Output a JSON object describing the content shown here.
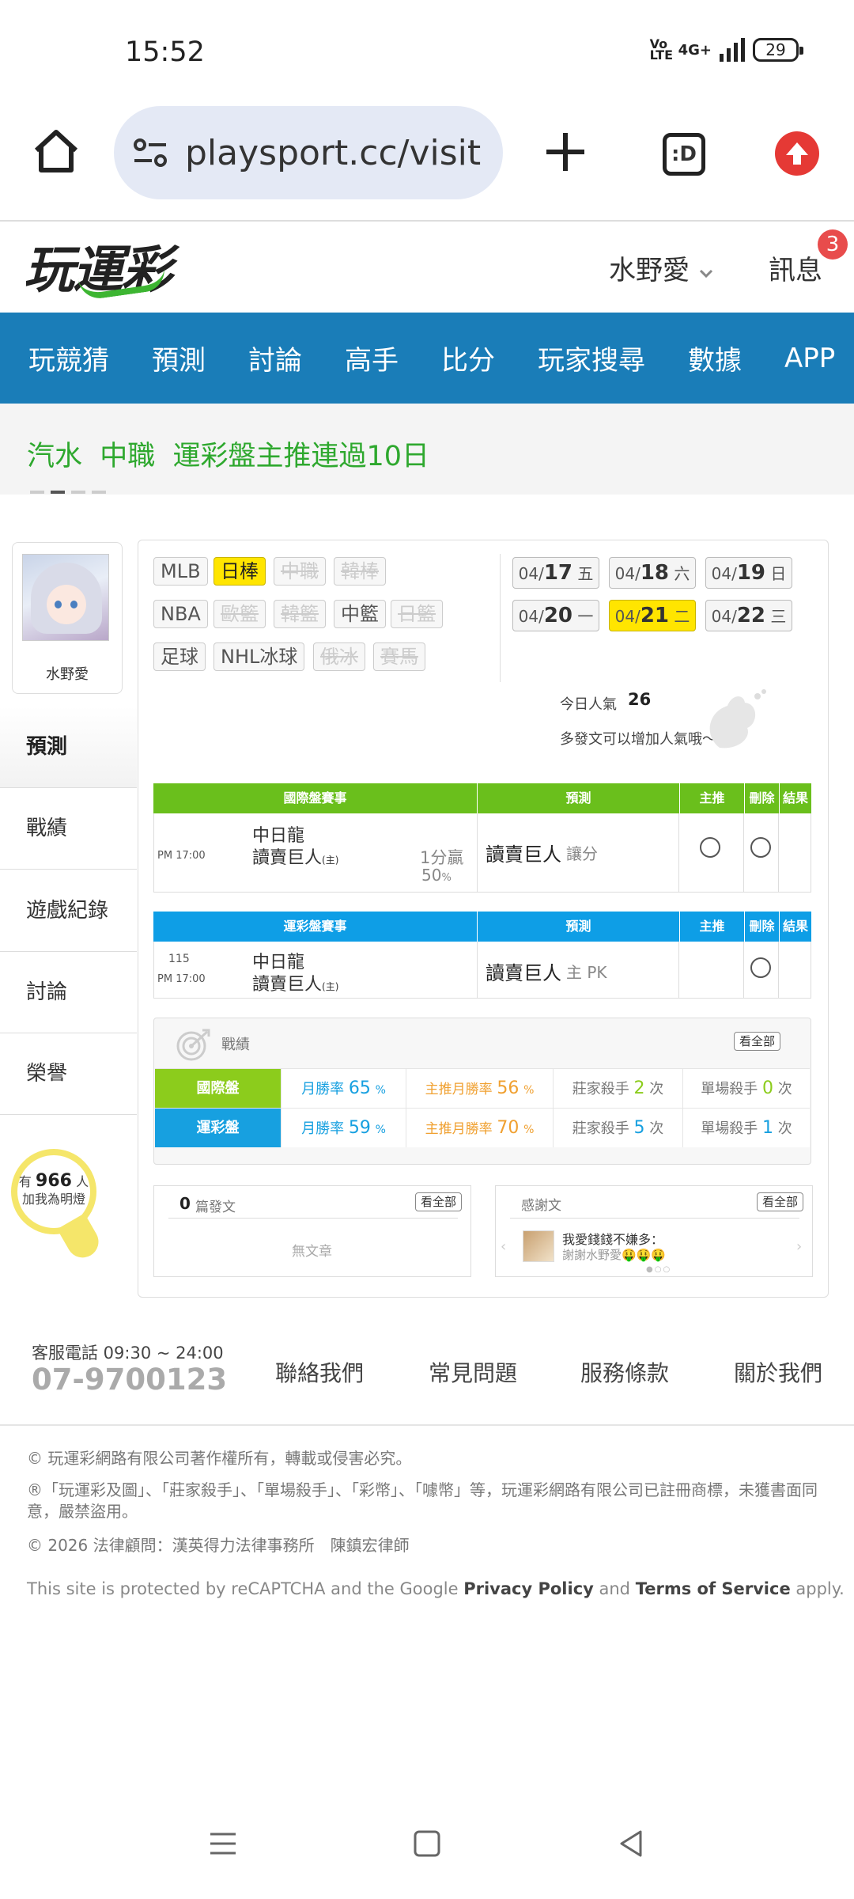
{
  "status_bar": {
    "time": "15:52",
    "network": "4G+",
    "volte": "Vo LTE",
    "battery": "29"
  },
  "browser": {
    "url": "playsport.cc/visit",
    "tab_label": ":D"
  },
  "site": {
    "logo": "玩運彩",
    "username": "水野愛",
    "messages_label": "訊息",
    "messages_badge": "3",
    "nav": [
      "玩競猜",
      "預測",
      "討論",
      "高手",
      "比分",
      "玩家搜尋",
      "數據",
      "APP"
    ],
    "banner": "汽水  中職  運彩盤主推連過10日"
  },
  "sidebar": {
    "avatar_name": "水野愛",
    "items": [
      "預測",
      "戰績",
      "遊戲紀錄",
      "討論",
      "榮譽"
    ],
    "bulb": {
      "prefix": "有",
      "count": "966",
      "suffix": "人",
      "line2": "加我為明燈"
    }
  },
  "sports": {
    "row1": [
      {
        "label": "MLB",
        "state": "normal"
      },
      {
        "label": "日棒",
        "state": "on"
      },
      {
        "label": "中職",
        "state": "off"
      },
      {
        "label": "韓棒",
        "state": "off"
      }
    ],
    "row2": [
      {
        "label": "NBA",
        "state": "normal"
      },
      {
        "label": "歐籃",
        "state": "off"
      },
      {
        "label": "韓籃",
        "state": "off"
      },
      {
        "label": "中籃",
        "state": "normal"
      },
      {
        "label": "日籃",
        "state": "off"
      }
    ],
    "row3": [
      {
        "label": "足球",
        "state": "normal"
      },
      {
        "label": "NHL冰球",
        "state": "normal"
      },
      {
        "label": "俄冰",
        "state": "off"
      },
      {
        "label": "賽馬",
        "state": "off"
      }
    ]
  },
  "dates": [
    {
      "md": "04/",
      "d": "17",
      "w": "五"
    },
    {
      "md": "04/",
      "d": "18",
      "w": "六"
    },
    {
      "md": "04/",
      "d": "19",
      "w": "日"
    },
    {
      "md": "04/",
      "d": "20",
      "w": "一"
    },
    {
      "md": "04/",
      "d": "21",
      "w": "二"
    },
    {
      "md": "04/",
      "d": "22",
      "w": "三"
    }
  ],
  "popularity": {
    "label": "今日人氣",
    "value": "26",
    "hint": "多發文可以增加人氣哦～"
  },
  "intl_table": {
    "headers": [
      "國際盤賽事",
      "預測",
      "主推",
      "刪除",
      "結果"
    ],
    "row": {
      "time": "PM 17:00",
      "away": "中日龍",
      "home": "讀賣巨人",
      "home_mark": "(主)",
      "line": "1分贏",
      "pct": "50",
      "pct_unit": "%",
      "pick": "讀賣巨人",
      "pick_note": "讓分"
    }
  },
  "lottery_table": {
    "headers": [
      "運彩盤賽事",
      "預測",
      "主推",
      "刪除",
      "結果"
    ],
    "row": {
      "code": "115",
      "time": "PM 17:00",
      "away": "中日龍",
      "home": "讀賣巨人",
      "home_mark": "(主)",
      "pick": "讀賣巨人",
      "pick_note": "主 PK"
    }
  },
  "stats": {
    "title": "戰績",
    "view_all": "看全部",
    "rows": [
      {
        "label": "國際盤",
        "m_label": "月勝率",
        "m_val": "65",
        "p_label": "主推月勝率",
        "p_val": "56",
        "unit": "%",
        "k_label": "莊家殺手",
        "k_val": "2",
        "k_unit": "次",
        "s_label": "單場殺手",
        "s_val": "0",
        "s_unit": "次"
      },
      {
        "label": "運彩盤",
        "m_label": "月勝率",
        "m_val": "59",
        "p_label": "主推月勝率",
        "p_val": "70",
        "unit": "%",
        "k_label": "莊家殺手",
        "k_val": "5",
        "k_unit": "次",
        "s_label": "單場殺手",
        "s_val": "1",
        "s_unit": "次"
      }
    ],
    "colors": {
      "intl": "#8ccc1c",
      "lottery": "#17a0e0"
    }
  },
  "posts": {
    "count": "0",
    "label": "篇發文",
    "view_all": "看全部",
    "empty": "無文章"
  },
  "thanks": {
    "title": "感謝文",
    "view_all": "看全部",
    "msg": "我愛錢錢不嫌多：",
    "sub": "謝謝水野愛🤑🤑🤑"
  },
  "footer": {
    "tel_label": "客服電話 09:30 ~ 24:00",
    "tel": "07-9700123",
    "links": [
      "聯絡我們",
      "常見問題",
      "服務條款",
      "關於我們"
    ],
    "copyright": "© 玩運彩網路有限公司著作權所有，轉載或侵害必究。",
    "trademark": "®「玩運彩及圖」、「莊家殺手」、「單場殺手」、「彩幣」、「噱幣」等，玩運彩網路有限公司已註冊商標，未獲書面同意，嚴禁盜用。",
    "legal": "© 2026 法律顧問：漢英得力法律事務所　陳鎮宏律師",
    "recaptcha_a": "This site is protected by reCAPTCHA and the Google ",
    "privacy": "Privacy Policy",
    "and": " and ",
    "terms": "Terms of Service",
    "apply": " apply."
  },
  "colors": {
    "nav": "#1a7db8",
    "green_head": "#6abf1c",
    "blue_head": "#0e9ee6",
    "highlight": "#ffe500",
    "banner_text": "#2ea82e"
  }
}
